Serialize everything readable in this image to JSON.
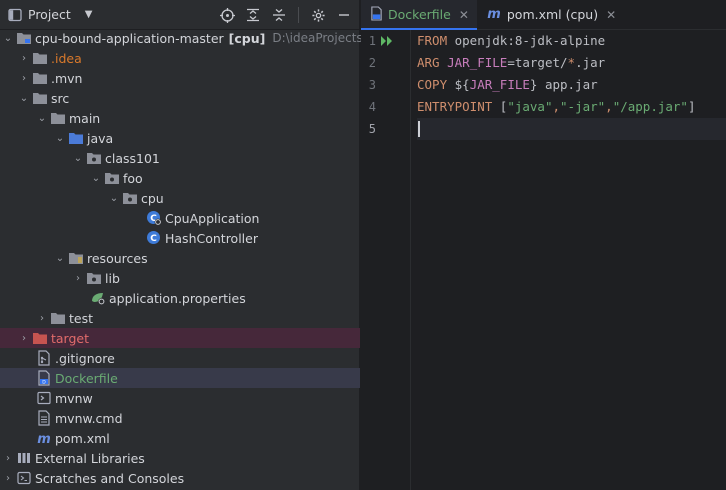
{
  "project_panel": {
    "title": "Project",
    "tools": [
      "locate-icon",
      "expand-all-icon",
      "collapse-all-icon",
      "gear-icon",
      "minimize-icon"
    ],
    "tree": [
      {
        "label": "cpu-bound-application-master",
        "bold": "[cpu]",
        "path": "D:\\ideaProjects\\cpu-",
        "icon": "module-folder-icon",
        "expanded": true
      },
      {
        "label": ".idea",
        "icon": "folder-icon",
        "expanded": false
      },
      {
        "label": ".mvn",
        "icon": "folder-icon",
        "expanded": false
      },
      {
        "label": "src",
        "icon": "folder-icon",
        "expanded": true
      },
      {
        "label": "main",
        "icon": "folder-icon",
        "expanded": true
      },
      {
        "label": "java",
        "icon": "source-folder-icon",
        "expanded": true
      },
      {
        "label": "class101",
        "icon": "package-icon",
        "expanded": true
      },
      {
        "label": "foo",
        "icon": "package-icon",
        "expanded": true
      },
      {
        "label": "cpu",
        "icon": "package-icon",
        "expanded": true
      },
      {
        "label": "CpuApplication",
        "icon": "spring-class-icon"
      },
      {
        "label": "HashController",
        "icon": "class-icon"
      },
      {
        "label": "resources",
        "icon": "resources-folder-icon",
        "expanded": true
      },
      {
        "label": "lib",
        "icon": "package-icon",
        "expanded": false
      },
      {
        "label": "application.properties",
        "icon": "spring-properties-icon"
      },
      {
        "label": "test",
        "icon": "folder-icon",
        "expanded": false
      },
      {
        "label": "target",
        "icon": "excluded-folder-icon",
        "expanded": false
      },
      {
        "label": ".gitignore",
        "icon": "gitignore-icon"
      },
      {
        "label": "Dockerfile",
        "icon": "dockerfile-icon"
      },
      {
        "label": "mvnw",
        "icon": "terminal-file-icon"
      },
      {
        "label": "mvnw.cmd",
        "icon": "text-file-icon"
      },
      {
        "label": "pom.xml",
        "icon": "maven-icon"
      },
      {
        "label": "External Libraries",
        "icon": "libraries-icon",
        "expanded": false
      },
      {
        "label": "Scratches and Consoles",
        "icon": "scratches-icon",
        "expanded": false
      }
    ]
  },
  "editor": {
    "tabs": [
      {
        "label": "Dockerfile",
        "icon": "dockerfile-icon",
        "active": true
      },
      {
        "label": "pom.xml (cpu)",
        "icon": "maven-icon",
        "active": false
      }
    ],
    "line_numbers": [
      "1",
      "2",
      "3",
      "4",
      "5"
    ],
    "lines": [
      [
        {
          "t": "FROM",
          "c": "kw"
        },
        {
          "t": " openjdk:8-jdk-alpine",
          "c": "tx"
        }
      ],
      [
        {
          "t": "ARG",
          "c": "kw"
        },
        {
          "t": " ",
          "c": "tx"
        },
        {
          "t": "JAR_FILE",
          "c": "var"
        },
        {
          "t": "=target/",
          "c": "tx"
        },
        {
          "t": "*",
          "c": "kw"
        },
        {
          "t": ".jar",
          "c": "tx"
        }
      ],
      [
        {
          "t": "COPY",
          "c": "kw"
        },
        {
          "t": " ${",
          "c": "tx"
        },
        {
          "t": "JAR_FILE",
          "c": "var"
        },
        {
          "t": "} app.jar",
          "c": "tx"
        }
      ],
      [
        {
          "t": "ENTRYPOINT",
          "c": "kw"
        },
        {
          "t": " [",
          "c": "tx"
        },
        {
          "t": "\"java\"",
          "c": "str"
        },
        {
          "t": ",",
          "c": "kw"
        },
        {
          "t": "\"-jar\"",
          "c": "str"
        },
        {
          "t": ",",
          "c": "kw"
        },
        {
          "t": "\"/app.jar\"",
          "c": "str"
        },
        {
          "t": "]",
          "c": "tx"
        }
      ],
      []
    ]
  },
  "colors": {
    "accent": "#3574f0",
    "selected_row": "#383a4a",
    "excluded_row": "#46283a",
    "keyword": "#cf8e6d",
    "string": "#6aab73",
    "variable": "#c77dbb"
  }
}
